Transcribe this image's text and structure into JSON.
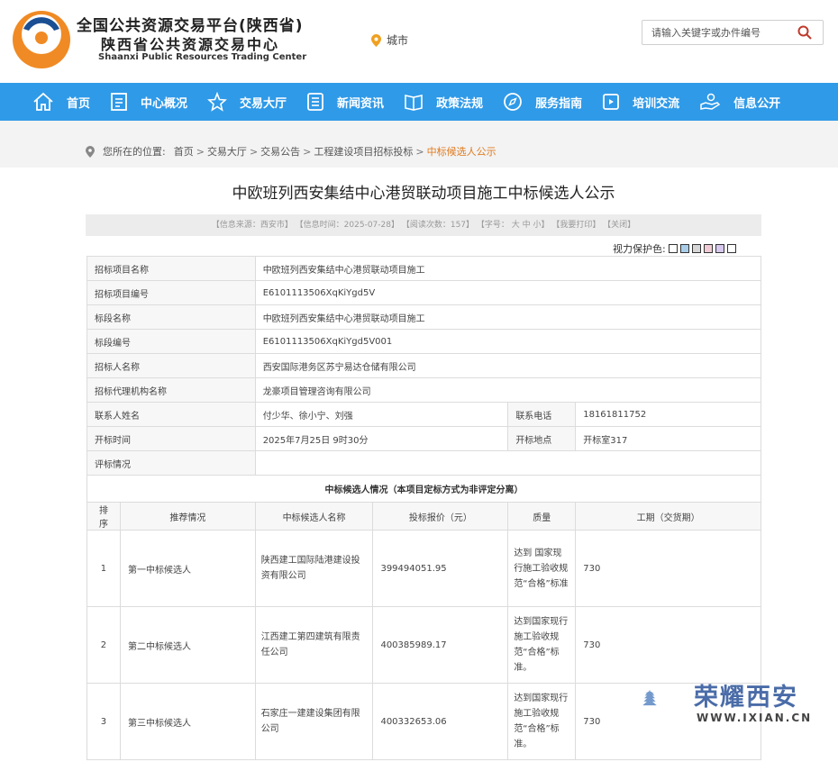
{
  "header": {
    "title_cn_1": "全国公共资源交易平台(陕西省)",
    "title_cn_2": "陕西省公共资源交易中心",
    "title_en": "Shaanxi Public Resources Trading Center",
    "city_label": "城市",
    "search_placeholder": "请输入关键字或办件编号",
    "brand_colors": {
      "orange": "#f08a24",
      "blue": "#1b4f93",
      "nav": "#2f9ae8"
    }
  },
  "nav": {
    "items": [
      {
        "label": "首页",
        "icon": "home-icon"
      },
      {
        "label": "中心概况",
        "icon": "document-icon"
      },
      {
        "label": "交易大厅",
        "icon": "star-hall-icon"
      },
      {
        "label": "新闻资讯",
        "icon": "news-icon"
      },
      {
        "label": "政策法规",
        "icon": "book-icon"
      },
      {
        "label": "服务指南",
        "icon": "compass-icon"
      },
      {
        "label": "培训交流",
        "icon": "video-icon"
      },
      {
        "label": "信息公开",
        "icon": "hand-icon"
      }
    ]
  },
  "breadcrumb": {
    "prefix": "您所在的位置:",
    "items": [
      "首页",
      "交易大厅",
      "交易公告",
      "工程建设项目招标投标"
    ],
    "current": "中标候选人公示",
    "separator": ">"
  },
  "page": {
    "title": "中欧班列西安集结中心港贸联动项目施工中标候选人公示",
    "meta": "【信息来源：西安市】 【信息时间：2025-07-28】 【阅读次数：157】 【字号： 大 中 小】 【我要打印】 【关闭】",
    "vision_label": "视力保护色:"
  },
  "info_rows": [
    {
      "label": "招标项目名称",
      "value": "中欧班列西安集结中心港贸联动项目施工"
    },
    {
      "label": "招标项目编号",
      "value": "E6101113506XqKiYgd5V"
    },
    {
      "label": "标段名称",
      "value": "中欧班列西安集结中心港贸联动项目施工"
    },
    {
      "label": "标段编号",
      "value": "E6101113506XqKiYgd5V001"
    },
    {
      "label": "招标人名称",
      "value": "西安国际港务区苏宁易达仓储有限公司"
    },
    {
      "label": "招标代理机构名称",
      "value": "龙豪项目管理咨询有限公司"
    }
  ],
  "contact_row": {
    "label": "联系人姓名",
    "value": "付少华、徐小宁、刘强",
    "label2": "联系电话",
    "value2": "18161811752"
  },
  "open_row": {
    "label": "开标时间",
    "value": "2025年7月25日 9时30分",
    "label2": "开标地点",
    "value2": "开标室317"
  },
  "eval_row": {
    "label": "评标情况",
    "value": ""
  },
  "candidates": {
    "section_title": "中标候选人情况（本项目定标方式为非评定分离）",
    "headers": [
      "排序",
      "推荐情况",
      "中标候选人名称",
      "投标报价（元）",
      "质量",
      "工期（交货期）"
    ],
    "rows": [
      {
        "rank": "1",
        "recommend": "第一中标候选人",
        "name": "陕西建工国际陆港建设投资有限公司",
        "price": "399494051.95",
        "quality": "达到 国家现行施工验收规范“合格”标准",
        "period": "730"
      },
      {
        "rank": "2",
        "recommend": "第二中标候选人",
        "name": "江西建工第四建筑有限责任公司",
        "price": "400385989.17",
        "quality": "达到国家现行施工验收规范“合格”标准。",
        "period": "730"
      },
      {
        "rank": "3",
        "recommend": "第三中标候选人",
        "name": "石家庄一建建设集团有限公司",
        "price": "400332653.06",
        "quality": "达到国家现行施工验收规范“合格”标准。",
        "period": "730"
      }
    ]
  },
  "watermark": {
    "text": "荣耀西安",
    "url": "WWW.IXIAN.CN"
  }
}
